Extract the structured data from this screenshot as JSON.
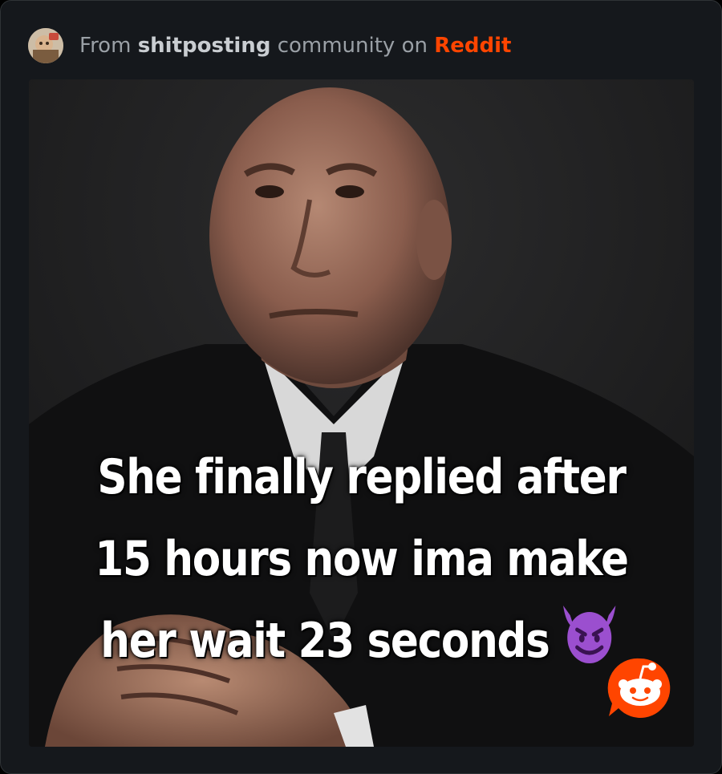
{
  "header": {
    "prefix": "From",
    "community": "shitposting",
    "middle": "community on",
    "platform": "Reddit",
    "avatar_icon": "community-avatar"
  },
  "post": {
    "image_caption": {
      "line1": "She finally replied after",
      "line2": "15 hours now ima make",
      "line3": "her wait 23 seconds"
    },
    "emoji": "smiling-face-with-horns",
    "watermark_icon": "reddit-logo-icon"
  },
  "colors": {
    "background": "#000000",
    "card": "#15181c",
    "border": "#2f3336",
    "muted_text": "#9aa0a6",
    "community_text": "#c9cdd1",
    "brand_orange": "#ff4500",
    "caption_text": "#ffffff",
    "emoji_purple": "#9b4fcf"
  }
}
